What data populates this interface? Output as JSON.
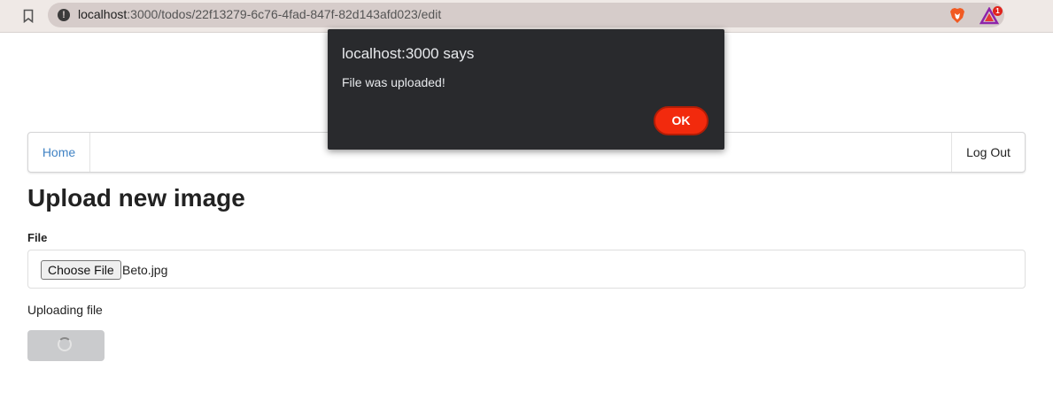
{
  "browser": {
    "url_host": "localhost",
    "url_path": ":3000/todos/22f13279-6c76-4fad-847f-82d143afd023/edit",
    "rewards_badge": "1",
    "icons": [
      "bookmark-icon",
      "info-icon",
      "brave-shield-icon",
      "brave-rewards-icon"
    ],
    "colors": {
      "toolbar": "#efe9e6",
      "url_field": "#d6ccca"
    }
  },
  "navbar": {
    "home_label": "Home",
    "logout_label": "Log Out"
  },
  "page": {
    "title": "Upload new image",
    "file_label": "File",
    "choose_button_label": "Choose File",
    "file_name": "Beto.jpg",
    "status_text": "Uploading file"
  },
  "dialog": {
    "title": "localhost:3000 says",
    "message": "File was uploaded!",
    "ok_label": "OK",
    "colors": {
      "background": "#292a2d",
      "ok_button": "#f22a0d"
    }
  }
}
